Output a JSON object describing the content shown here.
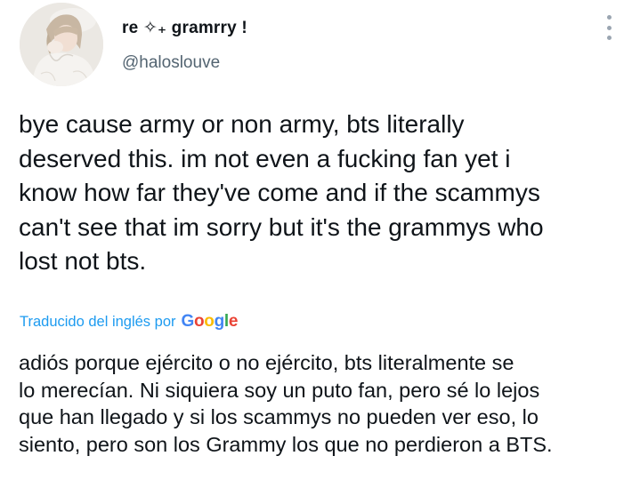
{
  "tweet": {
    "author": {
      "display_name": "re ✧₊ gramrry !",
      "handle": "@haloslouve",
      "avatar_icon": "profile-photo-avatar"
    },
    "more_icon": "vertical-dots-icon",
    "text_lines": [
      "bye cause army or non army, bts literally",
      "deserved this. im not even a fucking fan yet i",
      "know how far they've come and if the scammys",
      "can't see that im sorry but it's the grammys who",
      "lost not bts."
    ],
    "translation": {
      "label": "Traducido del inglés por",
      "provider": "Google",
      "provider_colors": [
        "#4285F4",
        "#EA4335",
        "#FBBC05",
        "#4285F4",
        "#34A853",
        "#EA4335"
      ],
      "lines": [
        "adiós porque ejército o no ejército, bts literalmente se",
        "lo merecían. Ni siquiera soy un puto fan, pero sé lo lejos",
        "que han llegado y si los scammys no pueden ver eso, lo",
        "siento, pero son los Grammy los que no perdieron a BTS."
      ]
    },
    "colors": {
      "text": "#0f1419",
      "secondary": "#536471",
      "link": "#1d9bf0"
    }
  }
}
